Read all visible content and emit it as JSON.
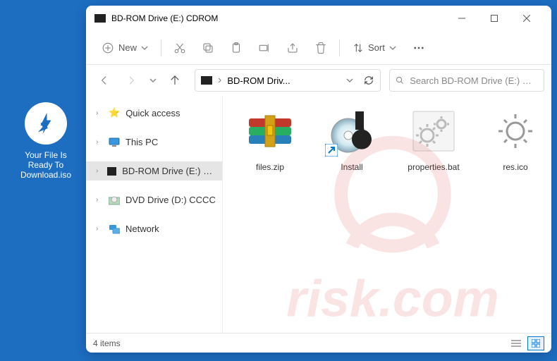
{
  "desktop": {
    "icon_label": "Your File Is Ready To Download.iso"
  },
  "window": {
    "title": "BD-ROM Drive (E:) CDROM"
  },
  "toolbar": {
    "new_label": "New",
    "sort_label": "Sort"
  },
  "address": {
    "crumb": "BD-ROM Driv..."
  },
  "search": {
    "placeholder": "Search BD-ROM Drive (E:) CDROM"
  },
  "sidebar": {
    "items": [
      {
        "label": "Quick access"
      },
      {
        "label": "This PC"
      },
      {
        "label": "BD-ROM Drive (E:) CDROM"
      },
      {
        "label": "DVD Drive (D:) CCCC"
      },
      {
        "label": "Network"
      }
    ]
  },
  "files": [
    {
      "name": "files.zip"
    },
    {
      "name": "Install"
    },
    {
      "name": "properties.bat"
    },
    {
      "name": "res.ico"
    }
  ],
  "statusbar": {
    "count": "4 items"
  }
}
